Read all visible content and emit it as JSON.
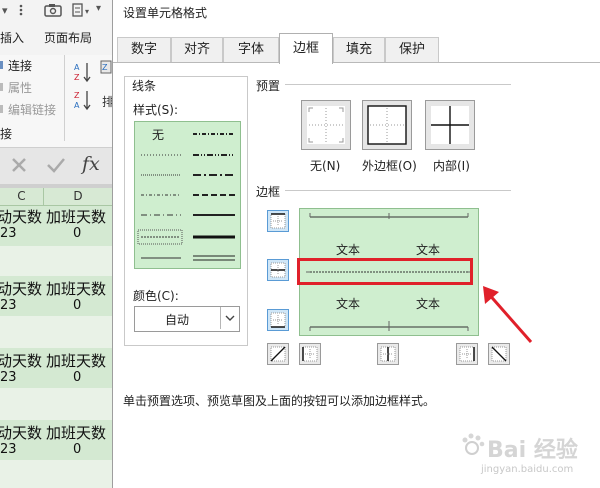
{
  "excel": {
    "ribbon": {
      "insert_tab": "插入",
      "page_layout_tab": "页面布局",
      "connections": "连接",
      "properties": "属性",
      "edit_links": "编辑链接",
      "connections_group": "接",
      "fx_label": "fx"
    },
    "columns": [
      "C",
      "D"
    ],
    "blocks": [
      {
        "c": "动天数",
        "d": "加班天数",
        "c_val": "23",
        "d_val": "0"
      },
      {
        "c": "动天数",
        "d": "加班天数",
        "c_val": "23",
        "d_val": "0"
      },
      {
        "c": "动天数",
        "d": "加班天数",
        "c_val": "23",
        "d_val": "0"
      },
      {
        "c": "动天数",
        "d": "加班天数",
        "c_val": "23",
        "d_val": "0"
      }
    ]
  },
  "dialog": {
    "title": "设置单元格格式",
    "tabs": [
      "数字",
      "对齐",
      "字体",
      "边框",
      "填充",
      "保护"
    ],
    "active_tab": "边框",
    "line": {
      "group_label": "线条",
      "style_label": "样式(S):",
      "none_style": "无",
      "color_label": "颜色(C):",
      "color_value": "自动"
    },
    "presets": {
      "group_label": "预置",
      "none": "无(N)",
      "outline": "外边框(O)",
      "inside": "内部(I)"
    },
    "border": {
      "group_label": "边框",
      "sample_text": "文本"
    },
    "hint": "单击预置选项、预览草图及上面的按钮可以添加边框样式。"
  },
  "watermark": {
    "brand": "Bai 经验",
    "url": "jingyan.baidu.com"
  },
  "colors": {
    "highlight": "#e0202a",
    "preview_bg": "#cfeecf",
    "excel_green": "#d4e9d2"
  }
}
